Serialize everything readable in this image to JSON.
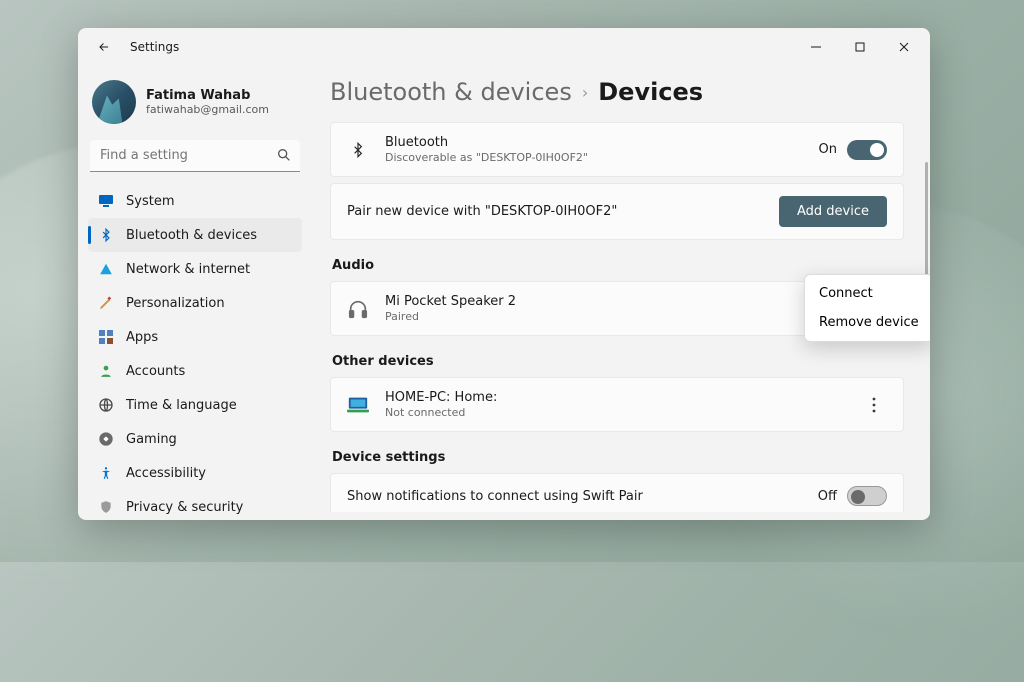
{
  "window": {
    "title": "Settings"
  },
  "profile": {
    "name": "Fatima Wahab",
    "email": "fatiwahab@gmail.com"
  },
  "search": {
    "placeholder": "Find a setting"
  },
  "nav": {
    "items": [
      {
        "label": "System"
      },
      {
        "label": "Bluetooth & devices"
      },
      {
        "label": "Network & internet"
      },
      {
        "label": "Personalization"
      },
      {
        "label": "Apps"
      },
      {
        "label": "Accounts"
      },
      {
        "label": "Time & language"
      },
      {
        "label": "Gaming"
      },
      {
        "label": "Accessibility"
      },
      {
        "label": "Privacy & security"
      }
    ]
  },
  "breadcrumb": {
    "parent": "Bluetooth & devices",
    "current": "Devices"
  },
  "bluetooth": {
    "title": "Bluetooth",
    "subtitle": "Discoverable as \"DESKTOP-0IH0OF2\"",
    "state_label": "On"
  },
  "pair": {
    "text": "Pair new device with \"DESKTOP-0IH0OF2\"",
    "button": "Add device"
  },
  "sections": {
    "audio": "Audio",
    "other": "Other devices",
    "settings": "Device settings"
  },
  "audio_device": {
    "name": "Mi Pocket Speaker 2",
    "status": "Paired"
  },
  "other_device": {
    "name": "HOME-PC: Home:",
    "status": "Not connected"
  },
  "swift_pair": {
    "title": "Show notifications to connect using Swift Pair",
    "state_label": "Off"
  },
  "context_menu": {
    "connect": "Connect",
    "remove": "Remove device"
  }
}
